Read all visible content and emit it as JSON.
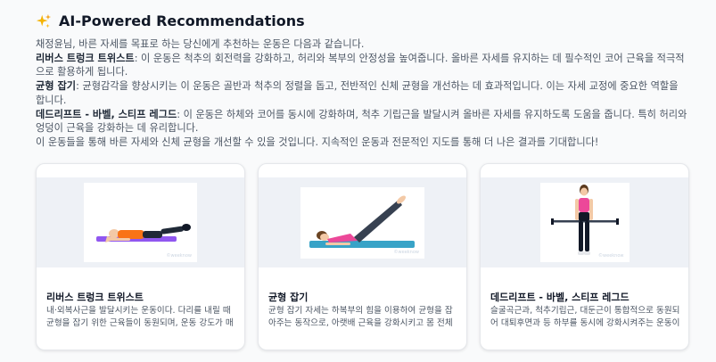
{
  "header": {
    "title": "AI-Powered Recommendations",
    "icon": "sparkles-icon"
  },
  "intro": "채정윤님, 바른 자세를 목표로 하는 당신에게 추천하는 운동은 다음과 같습니다.",
  "recs": [
    {
      "name": "리버스 트렁크 트위스트",
      "desc": ": 이 운동은 척추의 회전력을 강화하고, 허리와 복부의 안정성을 높여줍니다. 올바른 자세를 유지하는 데 필수적인 코어 근육을 적극적으로 활용하게 됩니다."
    },
    {
      "name": "균형 잡기",
      "desc": ": 균형감각을 향상시키는 이 운동은 골반과 척추의 정렬을 돕고, 전반적인 신체 균형을 개선하는 데 효과적입니다. 이는 자세 교정에 중요한 역할을 합니다."
    },
    {
      "name": "데드리프트 - 바벨, 스티프 레그드",
      "desc": ": 이 운동은 하체와 코어를 동시에 강화하며, 척추 기립근을 발달시켜 올바른 자세를 유지하도록 도움을 줍니다. 특히 허리와 엉덩이 근육을 강화하는 데 유리합니다."
    }
  ],
  "closing": "이 운동들을 통해 바른 자세와 신체 균형을 개선할 수 있을 것입니다. 지속적인 운동과 전문적인 지도를 통해 더 나은 결과를 기대합니다!",
  "cards": [
    {
      "title": "리버스 트렁크 트위스트",
      "text": "내·외복사근을 발달시키는 운동이다. 다리를 내릴 때 균형을 잡기 위한 근육들이 동원되며, 운동 강도가 매",
      "image": "lying-leg-twist-illustration",
      "watermark": "©weeknow"
    },
    {
      "title": "균형 잡기",
      "text": "균형 잡기 자세는 하복부의 힘을 이용하여 균형을 잡아주는 동작으로, 아랫배 근육을 강화시키고 몸 전체",
      "image": "leg-raise-illustration",
      "watermark": "©weeknow"
    },
    {
      "title": "데드리프트 - 바벨, 스티프 레그드",
      "text": "슬굴곡근과, 척추기립근, 대둔근이 통합적으로 동원되어 대퇴후면과 등 하부를 동시에 강화시켜주는 운동이",
      "image": "standing-barbell-illustration",
      "watermark": "©weeknow"
    }
  ],
  "colors": {
    "accent": "#f59e0b",
    "title": "#111827",
    "body": "#4b5563"
  }
}
